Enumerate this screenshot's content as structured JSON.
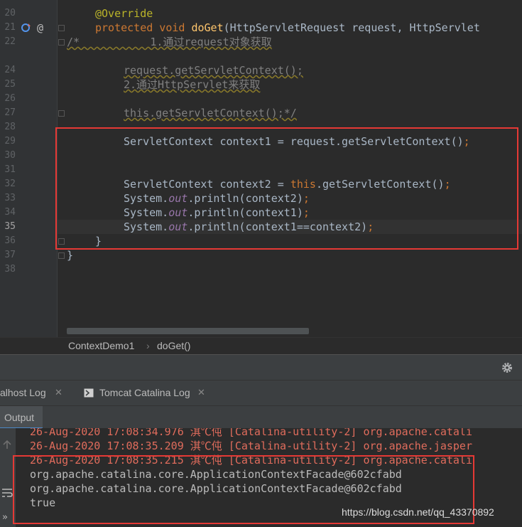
{
  "editor": {
    "line_numbers": [
      "20",
      "21",
      "22",
      "23",
      "24",
      "25",
      "26",
      "27",
      "28",
      "29",
      "30",
      "31",
      "32",
      "33",
      "34",
      "35",
      "36",
      "37",
      "38"
    ],
    "lines": {
      "l20": "@Override",
      "l21_kw": "protected void ",
      "l21_fn": "doGet",
      "l21_rest": "(HttpServletRequest request, HttpServlet",
      "l22": "/*           1.通过request对象获取",
      "l24": "request.getServletContext();",
      "l25": "2.通过HttpServlet来获取",
      "l27": "this.getServletContext();*/",
      "l29a": "ServletContext context1 = request.getServletContext()",
      "l29b": ";",
      "l32a": "ServletContext context2 = ",
      "l32b": "this",
      "l32c": ".getServletContext()",
      "l32d": ";",
      "l33a": "System.",
      "l33b": "out",
      "l33c": ".println(context2)",
      "l33d": ";",
      "l34a": "System.",
      "l34b": "out",
      "l34c": ".println(context1)",
      "l34d": ";",
      "l35a": "System.",
      "l35b": "out",
      "l35c": ".println(context1==context2)",
      "l35d": ";",
      "l36": "}",
      "l37": "}"
    }
  },
  "breadcrumb": {
    "class_name": "ContextDemo1",
    "separator": "›",
    "method": "doGet()"
  },
  "tabs": {
    "localhost_log": "alhost Log",
    "catalina_log": "Tomcat Catalina Log",
    "close": "✕"
  },
  "subtab": {
    "output": "Output"
  },
  "console": {
    "lines": [
      "26-Aug-2020 17:08:34.976 淇℃伅 [Catalina-utility-2] org.apache.catali",
      "26-Aug-2020 17:08:35.209 淇℃伅 [Catalina-utility-2] org.apache.jasper",
      "26-Aug-2020 17:08:35.215 淇℃伅 [Catalina-utility-2] org.apache.catali"
    ],
    "output": [
      "org.apache.catalina.core.ApplicationContextFacade@602cfabd",
      "org.apache.catalina.core.ApplicationContextFacade@602cfabd",
      "true"
    ]
  },
  "watermark": "https://blog.csdn.net/qq_43370892",
  "icons": [
    "override-gutter-icon",
    "annotation-gutter-icon",
    "gear-icon",
    "terminal-icon",
    "up-arrow-icon",
    "soft-wrap-icon",
    "more-icon"
  ],
  "colors": {
    "keyword": "#cc7832",
    "annotation": "#bbb529",
    "method": "#ffc66d",
    "static_field": "#9876aa",
    "comment": "#808080",
    "highlight_box": "#e53935"
  }
}
